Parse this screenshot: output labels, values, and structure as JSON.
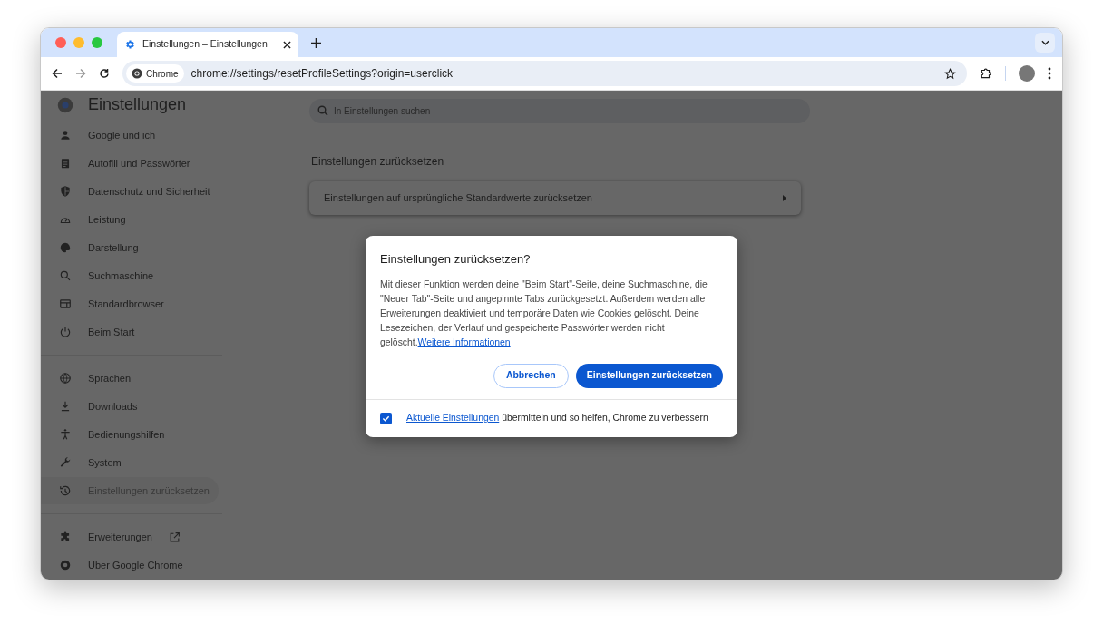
{
  "window": {
    "title": "Einstellungen – Einstellungen"
  },
  "toolbar": {
    "site_chip": "Chrome",
    "url": "chrome://settings/resetProfileSettings?origin=userclick"
  },
  "sidebar": {
    "title": "Einstellungen",
    "sections": [
      [
        {
          "label": "Google und ich",
          "selected": false,
          "kind": "page"
        },
        {
          "label": "Autofill und Passwörter",
          "selected": false,
          "kind": "page"
        },
        {
          "label": "Datenschutz und Sicherheit",
          "selected": false,
          "kind": "page"
        },
        {
          "label": "Leistung",
          "selected": false,
          "kind": "page"
        },
        {
          "label": "Darstellung",
          "selected": false,
          "kind": "page"
        },
        {
          "label": "Suchmaschine",
          "selected": false,
          "kind": "page"
        },
        {
          "label": "Standardbrowser",
          "selected": false,
          "kind": "page"
        },
        {
          "label": "Beim Start",
          "selected": false,
          "kind": "page"
        }
      ],
      [
        {
          "label": "Sprachen",
          "selected": false,
          "kind": "page"
        },
        {
          "label": "Downloads",
          "selected": false,
          "kind": "page"
        },
        {
          "label": "Bedienungshilfen",
          "selected": false,
          "kind": "page"
        },
        {
          "label": "System",
          "selected": false,
          "kind": "page"
        },
        {
          "label": "Einstellungen zurücksetzen",
          "selected": true,
          "kind": "page"
        }
      ],
      [
        {
          "label": "Erweiterungen",
          "selected": false,
          "kind": "external"
        },
        {
          "label": "Über Google Chrome",
          "selected": false,
          "kind": "page"
        }
      ]
    ]
  },
  "search": {
    "placeholder": "In Einstellungen suchen"
  },
  "main": {
    "heading": "Einstellungen zurücksetzen",
    "row": "Einstellungen auf ursprüngliche Standardwerte zurücksetzen"
  },
  "dialog": {
    "title": "Einstellungen zurücksetzen?",
    "body": "Mit dieser Funktion werden deine \"Beim Start\"-Seite, deine Suchmaschine, die \"Neuer Tab\"-Seite und angepinnte Tabs zurückgesetzt. Außerdem werden alle Erweiterungen deaktiviert und temporäre Daten wie Cookies gelöscht. Deine Lesezeichen, der Verlauf und gespeicherte Passwörter werden nicht gelöscht.",
    "link": "Weitere Informationen",
    "buttons": [
      {
        "label": "Abbrechen",
        "kind": "secondary"
      },
      {
        "label": "Einstellungen zurücksetzen",
        "kind": "primary"
      }
    ],
    "report": {
      "checked": true,
      "link": "Aktuelle Einstellungen",
      "text": "übermitteln und so helfen, Chrome zu verbessern"
    }
  }
}
